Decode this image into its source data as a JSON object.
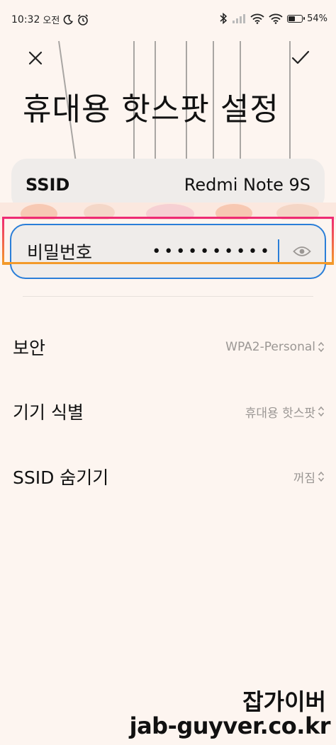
{
  "status_bar": {
    "time": "10:32",
    "ampm": "오전",
    "battery": "54%",
    "battery_level": 0.54
  },
  "toolbar": {
    "close_icon": "close-icon",
    "confirm_icon": "check-icon"
  },
  "page": {
    "title": "휴대용 핫스팟 설정"
  },
  "ssid": {
    "label": "SSID",
    "value": "Redmi Note 9S"
  },
  "password": {
    "label": "비밀번호",
    "value": "••••••••••",
    "visibility_icon": "eye-icon"
  },
  "settings": [
    {
      "label": "보안",
      "value": "WPA2-Personal"
    },
    {
      "label": "기기 식별",
      "value": "휴대용 핫스팟"
    },
    {
      "label": "SSID 숨기기",
      "value": "꺼짐"
    }
  ],
  "watermark": {
    "line1": "잡가이버",
    "line2": "jab-guyver.co.kr"
  },
  "colors": {
    "background": "#fdf5f0",
    "card": "#efecea",
    "focus_border": "#2a7ed8",
    "highlight_top": "#ef2a74",
    "highlight_bottom": "#f39a2a",
    "secondary_text": "#9b9794"
  }
}
